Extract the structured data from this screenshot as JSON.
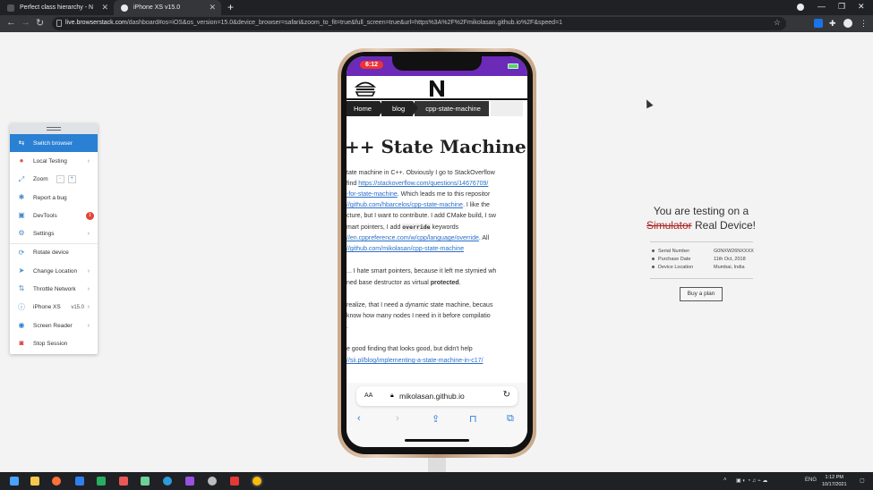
{
  "browser": {
    "tabs": [
      {
        "label": "Perfect class hierarchy - N",
        "active": false
      },
      {
        "label": "iPhone XS v15.0",
        "active": true
      }
    ],
    "url_host": "live.browserstack.com",
    "url_rest": "/dashboard#os=iOS&os_version=15.0&device_browser=safari&zoom_to_fit=true&full_screen=true&url=https%3A%2F%2Fmikolasan.github.io%2F&speed=1"
  },
  "panel": {
    "items": [
      {
        "label": "Switch browser",
        "icon": "switch-icon"
      },
      {
        "label": "Local Testing",
        "icon": "local-testing-icon"
      },
      {
        "label": "Zoom",
        "icon": "zoom-icon"
      },
      {
        "label": "Report a bug",
        "icon": "bug-icon"
      },
      {
        "label": "DevTools",
        "icon": "devtools-icon",
        "badge": "1"
      },
      {
        "label": "Settings",
        "icon": "gear-icon"
      },
      {
        "label": "Rotate device",
        "icon": "rotate-icon"
      },
      {
        "label": "Change Location",
        "icon": "location-icon"
      },
      {
        "label": "Throttle Network",
        "icon": "network-icon"
      },
      {
        "label": "iPhone XS",
        "icon": "info-icon",
        "value": "v15.0"
      },
      {
        "label": "Screen Reader",
        "icon": "accessibility-icon"
      },
      {
        "label": "Stop Session",
        "icon": "stop-icon"
      }
    ],
    "zoom_minus": "-",
    "zoom_plus": "+"
  },
  "phone": {
    "time": "6:12",
    "breadcrumbs": [
      "Home",
      "blog",
      "cpp-state-machine"
    ],
    "title": "++ State Machine",
    "address_aa": "AA",
    "address_host": "mikolasan.github.io"
  },
  "article": {
    "l1": "tate machine in C++. Obviously I go to StackOverflow",
    "l2a": "find ",
    "l2link": "https://stackoverflow.com/questions/14676709/",
    "l3link": "-for-state-machine",
    "l3b": ". Which leads me to this repositor",
    "l4link": "//github.com/hbarcelos/cpp-state-machine",
    "l4b": ". I like the",
    "l5": "cture, but I want to contribute. I add CMake build, I sw",
    "l6a": "mart pointers, I add ",
    "l6code": "override",
    "l6b": " keywords",
    "l7link": "//en.cppreference.com/w/cpp/language/override",
    "l7b": ". All",
    "l8link": "//github.com/mikolasan/cpp-state-machine",
    "l9": "... I hate smart pointers, because it left me stymied wh",
    "l10a": "ned base destructor as virtual ",
    "l10b": "protected",
    "l10c": ".",
    "l11a": " realize, that I need a ",
    "l11i": "dynamic",
    "l11b": " state machine, becaus",
    "l12": " know how many nodes I need in it before compilatio",
    "l13": ".",
    "l14": "e good finding that looks good, but didn't help",
    "l15link": "//sii.pl/blog/implementing-a-state-machine-in-c17/"
  },
  "promo": {
    "line1": "You are testing on a",
    "strike": "Simulator",
    "line2": " Real Device!",
    "specs": [
      {
        "k": "Serial Number",
        "v": "G0NXW26NXXXX"
      },
      {
        "k": "Purchase Date",
        "v": "11th Oct, 2018"
      },
      {
        "k": "Device Location",
        "v": "Mumbai, India"
      }
    ],
    "buy": "Buy a plan"
  },
  "taskbar": {
    "lang": "ENG",
    "time": "1:12 PM",
    "date": "10/17/2021"
  }
}
